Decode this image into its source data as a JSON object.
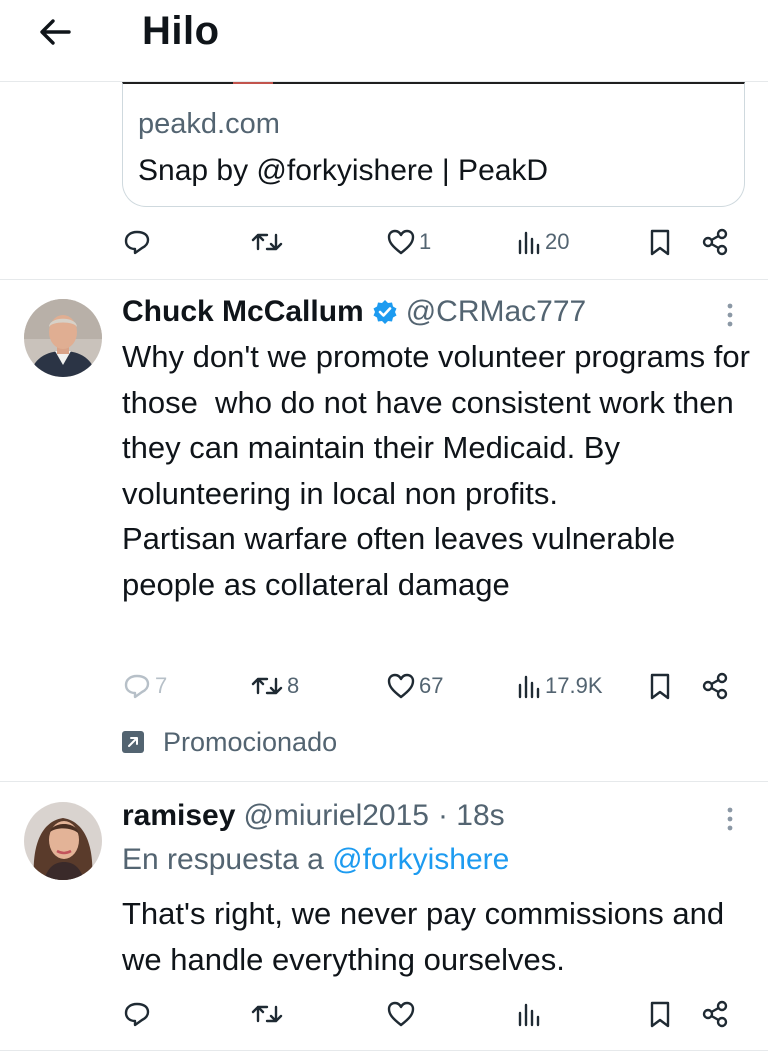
{
  "header": {
    "title": "Hilo",
    "back_icon": "arrow-left-icon"
  },
  "link_card": {
    "domain": "peakd.com",
    "title": "Snap by @forkyishere | PeakD"
  },
  "first_actions": {
    "replies": "",
    "retweets": "",
    "likes": "1",
    "views": "20"
  },
  "tweets": [
    {
      "display_name": "Chuck McCallum",
      "handle": "@CRMac777",
      "verified": true,
      "text": "Why don't we promote volunteer programs for those  who do not have consistent work then they can maintain their Medicaid. By volunteering in local non profits.\nPartisan warfare often leaves vulnerable people as collateral damage",
      "replies": "7",
      "retweets": "8",
      "likes": "67",
      "views": "17.9K",
      "promoted_label": "Promocionado"
    },
    {
      "display_name": "ramisey",
      "handle": "@miuriel2015",
      "time": "· 18s",
      "reply_prefix": "En respuesta a",
      "reply_mention": "@forkyishere",
      "text": "That's right, we never pay commissions and we handle everything ourselves.",
      "replies": "",
      "retweets": "",
      "likes": "",
      "views": ""
    }
  ],
  "colors": {
    "accent": "#1d9bf0",
    "muted": "#536471",
    "text": "#0f1419",
    "divider": "#e6e9eb"
  }
}
